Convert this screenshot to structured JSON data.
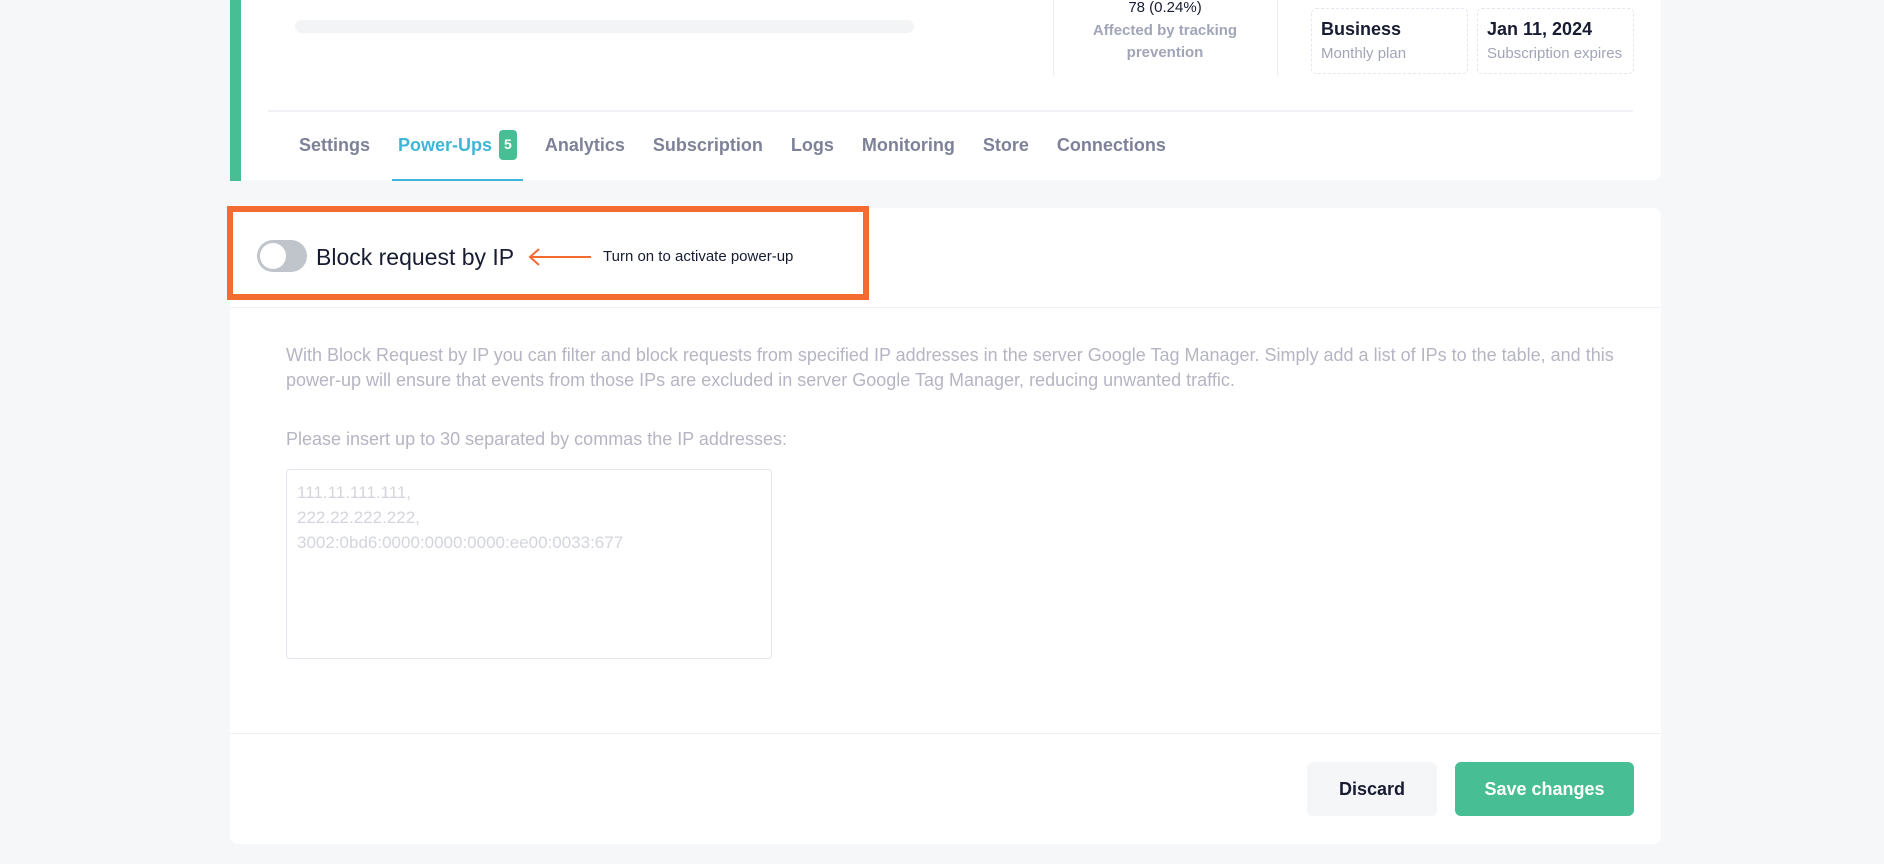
{
  "header": {
    "stat": {
      "value": "78 (0.24%)",
      "label_line1": "Affected by tracking",
      "label_line2": "prevention"
    },
    "plan": {
      "title": "Business",
      "subtitle": "Monthly plan"
    },
    "expiry": {
      "title": "Jan 11, 2024",
      "subtitle": "Subscription expires"
    }
  },
  "tabs": [
    {
      "label": "Settings"
    },
    {
      "label": "Power-Ups",
      "badge": "5",
      "active": true
    },
    {
      "label": "Analytics"
    },
    {
      "label": "Subscription"
    },
    {
      "label": "Logs"
    },
    {
      "label": "Monitoring"
    },
    {
      "label": "Store"
    },
    {
      "label": "Connections"
    }
  ],
  "powerup": {
    "title": "Block request by IP",
    "hint": "Turn on to activate power-up",
    "enabled": false,
    "description": "With Block Request by IP you can filter and block requests from specified IP addresses in the server Google Tag Manager. Simply add a list of IPs to the table, and this power-up will ensure that events from those IPs are excluded in server Google Tag Manager, reducing unwanted traffic.",
    "ip_label": "Please insert up to 30 separated by commas the IP addresses:",
    "ip_placeholder": "111.11.111.111,\n222.22.222.222,\n3002:0bd6:0000:0000:0000:ee00:0033:677"
  },
  "colors": {
    "accent_green": "#47be93",
    "active_tab": "#3fb6d8",
    "highlight_orange": "#f36b32"
  },
  "actions": {
    "discard_label": "Discard",
    "save_label": "Save changes"
  }
}
